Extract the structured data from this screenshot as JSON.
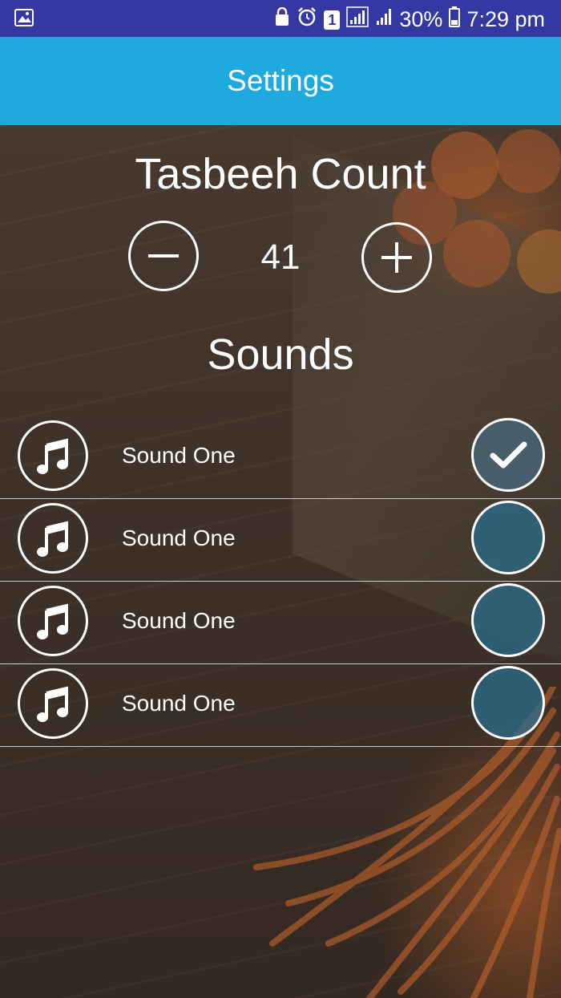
{
  "status_bar": {
    "battery_percent": "30%",
    "time": "7:29 pm",
    "sim_badge": "1"
  },
  "app_bar": {
    "title": "Settings"
  },
  "tasbeeh": {
    "title": "Tasbeeh Count",
    "value": "41"
  },
  "sounds": {
    "title": "Sounds",
    "items": [
      {
        "label": "Sound One",
        "selected": true
      },
      {
        "label": "Sound One",
        "selected": false
      },
      {
        "label": "Sound One",
        "selected": false
      },
      {
        "label": "Sound One",
        "selected": false
      }
    ]
  },
  "colors": {
    "status_bar": "#3338a3",
    "app_bar": "#1ea9df",
    "check_fill": "#2f7090"
  }
}
